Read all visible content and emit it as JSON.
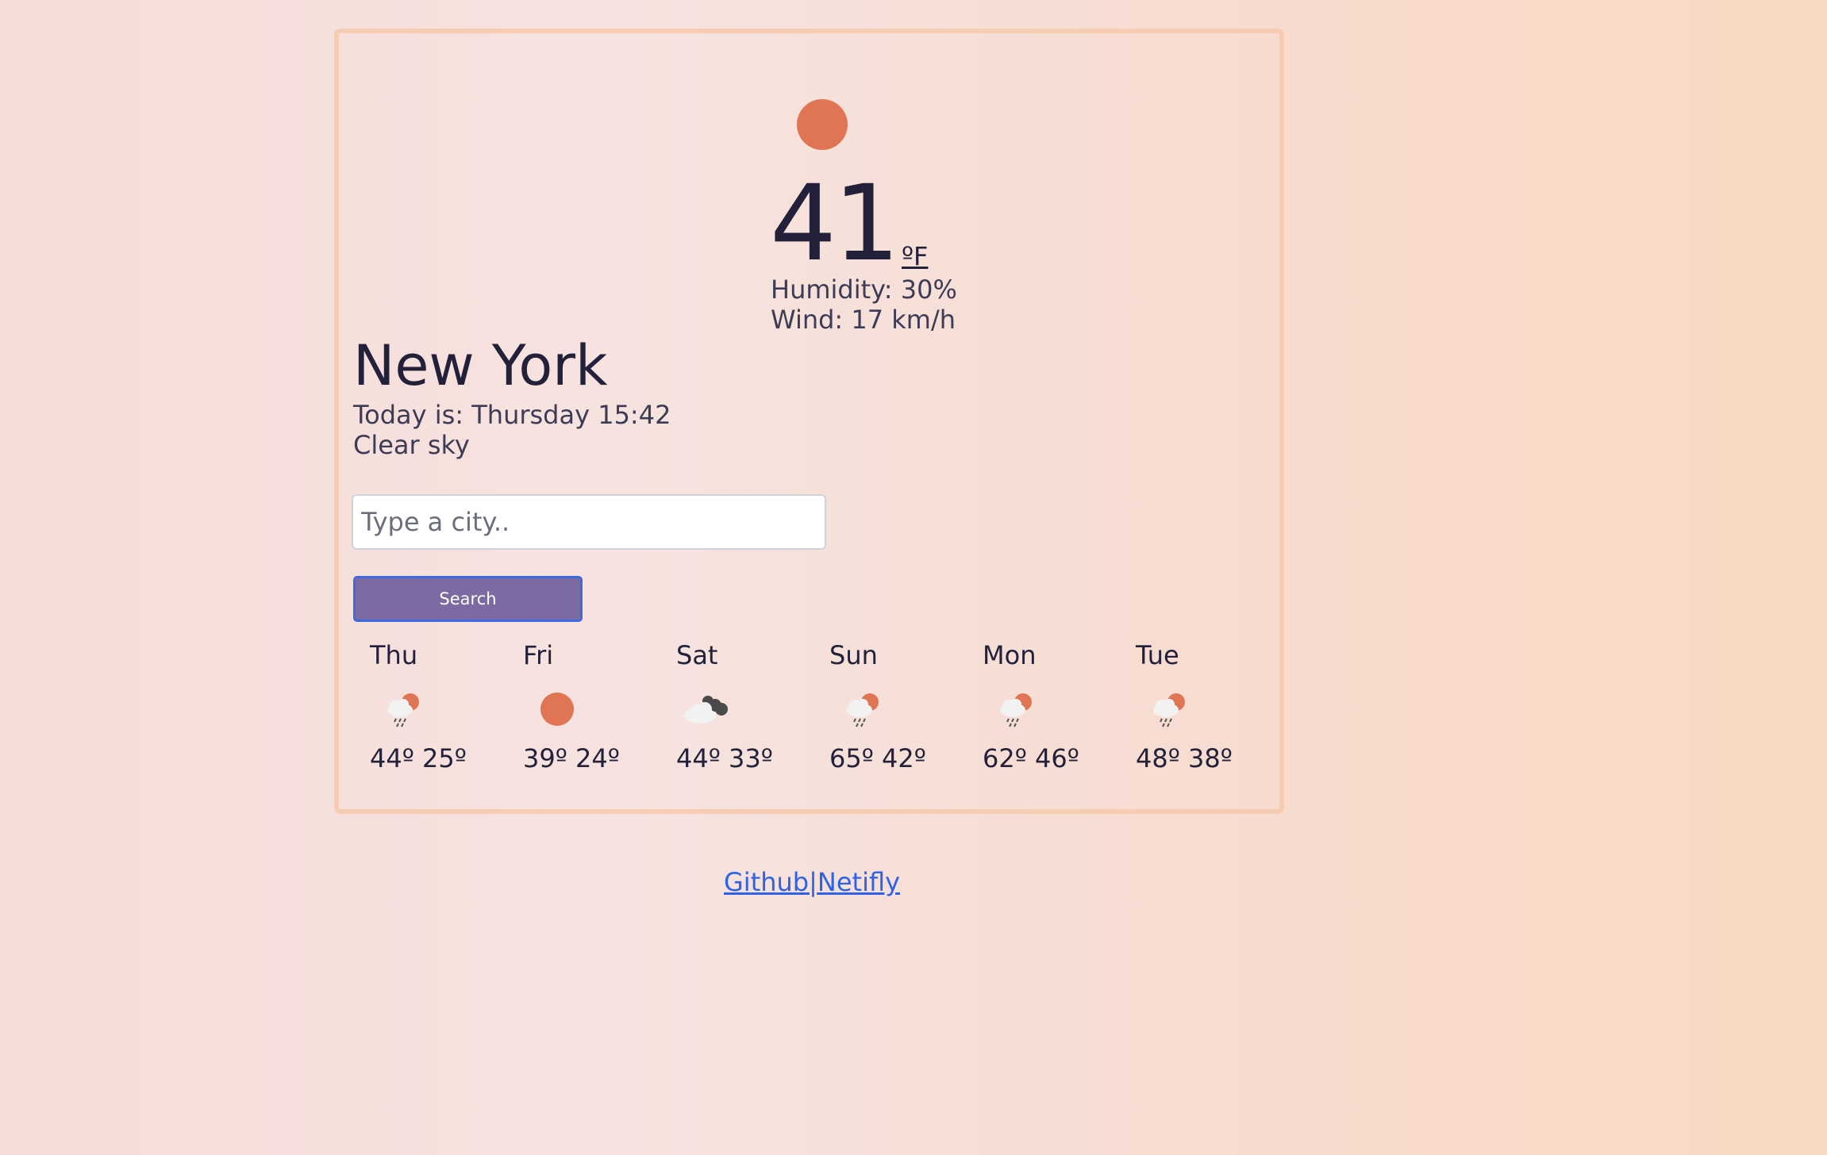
{
  "current": {
    "icon": "sun-icon",
    "temperature": "41",
    "unit": "ºF",
    "humidity": "Humidity: 30%",
    "wind": "Wind: 17 km/h"
  },
  "location": {
    "city": "New York",
    "date_text": "Today is: Thursday 15:42",
    "description": "Clear sky"
  },
  "search": {
    "placeholder": "Type a city..",
    "value": "",
    "button_label": "Search"
  },
  "forecast": [
    {
      "day": "Thu",
      "icon": "rain-cloud-sun-icon",
      "temps": "44º 25º"
    },
    {
      "day": "Fri",
      "icon": "sun-icon",
      "temps": "39º 24º"
    },
    {
      "day": "Sat",
      "icon": "broken-clouds-icon",
      "temps": "44º 33º"
    },
    {
      "day": "Sun",
      "icon": "rain-cloud-sun-icon",
      "temps": "65º 42º"
    },
    {
      "day": "Mon",
      "icon": "rain-cloud-sun-icon",
      "temps": "62º 46º"
    },
    {
      "day": "Tue",
      "icon": "rain-cloud-sun-icon",
      "temps": "48º 38º"
    }
  ],
  "footer": {
    "github_label": "Github",
    "separator": "|",
    "netlify_label": "Netifly"
  },
  "colors": {
    "sun": "#e07554",
    "text": "#23213a",
    "button": "#7c6aa2",
    "link": "#2f62e6"
  }
}
